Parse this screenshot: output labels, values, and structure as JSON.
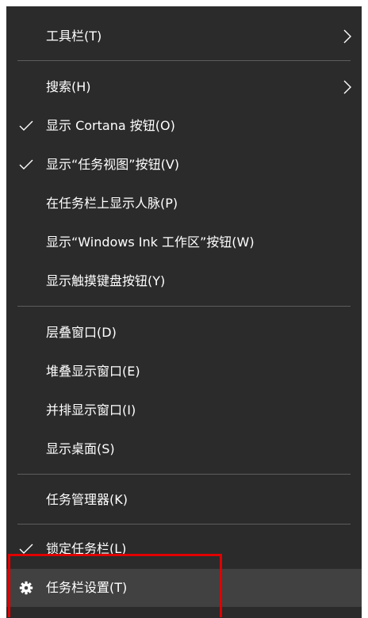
{
  "menu": {
    "items": [
      {
        "label": "工具栏(T)",
        "check": false,
        "submenu": true
      },
      {
        "label": "搜索(H)",
        "check": false,
        "submenu": true
      },
      {
        "label": "显示 Cortana 按钮(O)",
        "check": true,
        "submenu": false
      },
      {
        "label": "显示“任务视图”按钮(V)",
        "check": true,
        "submenu": false
      },
      {
        "label": "在任务栏上显示人脉(P)",
        "check": false,
        "submenu": false
      },
      {
        "label": "显示“Windows Ink 工作区”按钮(W)",
        "check": false,
        "submenu": false
      },
      {
        "label": "显示触摸键盘按钮(Y)",
        "check": false,
        "submenu": false
      },
      {
        "label": "层叠窗口(D)",
        "check": false,
        "submenu": false
      },
      {
        "label": "堆叠显示窗口(E)",
        "check": false,
        "submenu": false
      },
      {
        "label": "并排显示窗口(I)",
        "check": false,
        "submenu": false
      },
      {
        "label": "显示桌面(S)",
        "check": false,
        "submenu": false
      },
      {
        "label": "任务管理器(K)",
        "check": false,
        "submenu": false
      },
      {
        "label": "锁定任务栏(L)",
        "check": true,
        "submenu": false
      },
      {
        "label": "任务栏设置(T)",
        "check": false,
        "submenu": false,
        "icon": "gear-icon",
        "hovered": true
      }
    ]
  },
  "colors": {
    "menu_background": "#2b2b2b",
    "hover_background": "#414141",
    "separator": "#5d5d5d",
    "text": "#ffffff",
    "annotation_box": "#e10000"
  }
}
